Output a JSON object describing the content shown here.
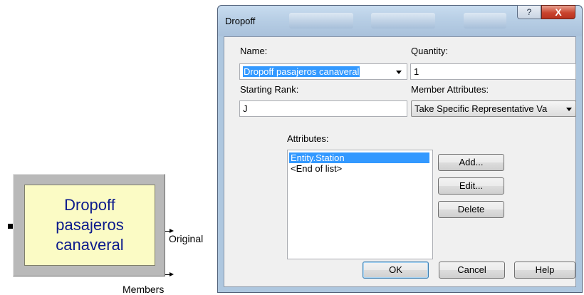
{
  "module": {
    "label": "Dropoff\npasajeros\ncanaveral",
    "ports": {
      "original": "Original",
      "members": "Members"
    }
  },
  "dialog": {
    "title": "Dropoff",
    "title_buttons": {
      "help": "?",
      "close": "X"
    },
    "fields": {
      "name_label": "Name:",
      "name_value": "Dropoff pasajeros canaveral",
      "quantity_label": "Quantity:",
      "quantity_value": "1",
      "starting_rank_label": "Starting Rank:",
      "starting_rank_value": "J",
      "member_attributes_label": "Member Attributes:",
      "member_attributes_value": "Take Specific Representative Va"
    },
    "attributes": {
      "label": "Attributes:",
      "items": [
        {
          "text": "Entity.Station",
          "selected": true
        },
        {
          "text": "<End of list>",
          "selected": false
        }
      ]
    },
    "buttons": {
      "add": "Add...",
      "edit": "Edit...",
      "delete": "Delete",
      "ok": "OK",
      "cancel": "Cancel",
      "help": "Help"
    }
  },
  "colors": {
    "module_fill": "#fbfbc5",
    "module_text": "#0b1a8c",
    "selection": "#3399ff",
    "close_button": "#c9442e"
  }
}
